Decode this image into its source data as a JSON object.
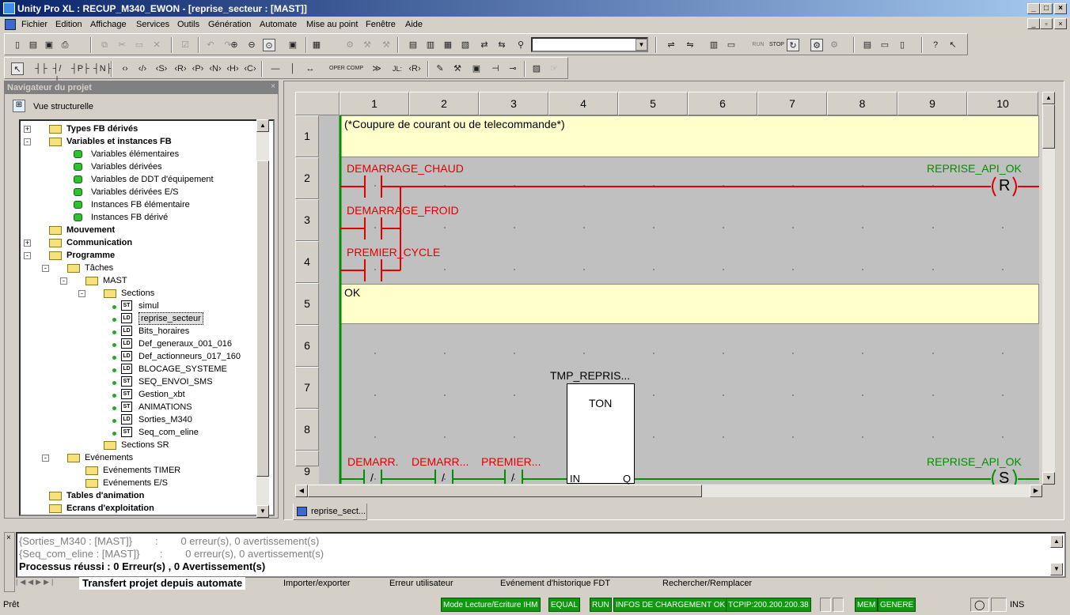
{
  "window": {
    "title": "Unity Pro XL : RECUP_M340_EWON - [reprise_secteur : [MAST]]"
  },
  "menu": [
    "Fichier",
    "Edition",
    "Affichage",
    "Services",
    "Outils",
    "Génération",
    "Automate",
    "Mise au point",
    "Fenêtre",
    "Aide"
  ],
  "navigator": {
    "title": "Navigateur du projet",
    "view_label": "Vue structurelle",
    "items": [
      "Types FB dérivés",
      "Variables et instances FB",
      "Variables élémentaires",
      "Variables dérivées",
      "Variables de DDT d'équipement",
      "Variables dérivées E/S",
      "Instances FB élémentaire",
      "Instances FB dérivé",
      "Mouvement",
      "Communication",
      "Programme",
      "Tâches",
      "MAST",
      "Sections",
      "simul",
      "reprise_secteur",
      "Bits_horaires",
      "Def_generaux_001_016",
      "Def_actionneurs_017_160",
      "BLOCAGE_SYSTEME",
      "SEQ_ENVOI_SMS",
      "Gestion_xbt",
      "ANIMATIONS",
      "Sorties_M340",
      "Seq_com_eline",
      "Sections SR",
      "Evénements",
      "Evénements TIMER",
      "Evénements E/S",
      "Tables d'animation",
      "Ecrans d'exploitation"
    ],
    "icon_types": [
      "ST",
      "LD",
      "LD",
      "LD",
      "LD",
      "LD",
      "ST",
      "ST",
      "ST",
      "LD",
      "ST"
    ]
  },
  "editor": {
    "columns": [
      "1",
      "2",
      "3",
      "4",
      "5",
      "6",
      "7",
      "8",
      "9",
      "10"
    ],
    "rows": [
      "1",
      "2",
      "3",
      "4",
      "5",
      "6",
      "7",
      "8",
      "9"
    ],
    "comment1": "(*Coupure de courant ou de telecommande*)",
    "comment2": "OK",
    "contact1": "DEMARRAGE_CHAUD",
    "contact2": "DEMARRAGE_FROID",
    "contact3": "PREMIER_CYCLE",
    "coil_reset_var": "REPRISE_API_OK",
    "coil_reset": "R",
    "timer_instance": "TMP_REPRIS...",
    "timer_type": "TON",
    "timer_in": "IN",
    "timer_q": "Q",
    "c9a": "DEMARR.",
    "c9b": "DEMARR...",
    "c9c": "PREMIER...",
    "contact_neg": "/",
    "coil_set_var": "REPRISE_API_OK",
    "coil_set": "S",
    "tab": "reprise_sect..."
  },
  "output": {
    "lines": [
      "{Sorties_M340 : [MAST]}        :        0 erreur(s), 0 avertissement(s)",
      "{Seq_com_eline : [MAST]}       :        0 erreur(s), 0 avertissement(s)",
      "Processus réussi  : 0 Erreur(s) , 0 Avertissement(s)"
    ],
    "tabs": [
      "Transfert projet depuis automate",
      "Importer/exporter",
      "Erreur utilisateur",
      "Evénement d'historique FDT",
      "Rechercher/Remplacer"
    ]
  },
  "status": {
    "ready": "Prêt",
    "mode": "Mode Lecture/Ecriture IHM",
    "equal": "EQUAL",
    "run": "RUN",
    "load": "INFOS DE CHARGEMENT OK",
    "tcpip": "TCPIP:200.200.200.38",
    "mem": "MEM",
    "gen": "GENERE",
    "ins": "INS"
  },
  "colors": {
    "energized": "#e00000",
    "output_green": "#009000",
    "rung_bg": "#c0c0c0",
    "comment_bg": "#ffffcc"
  }
}
